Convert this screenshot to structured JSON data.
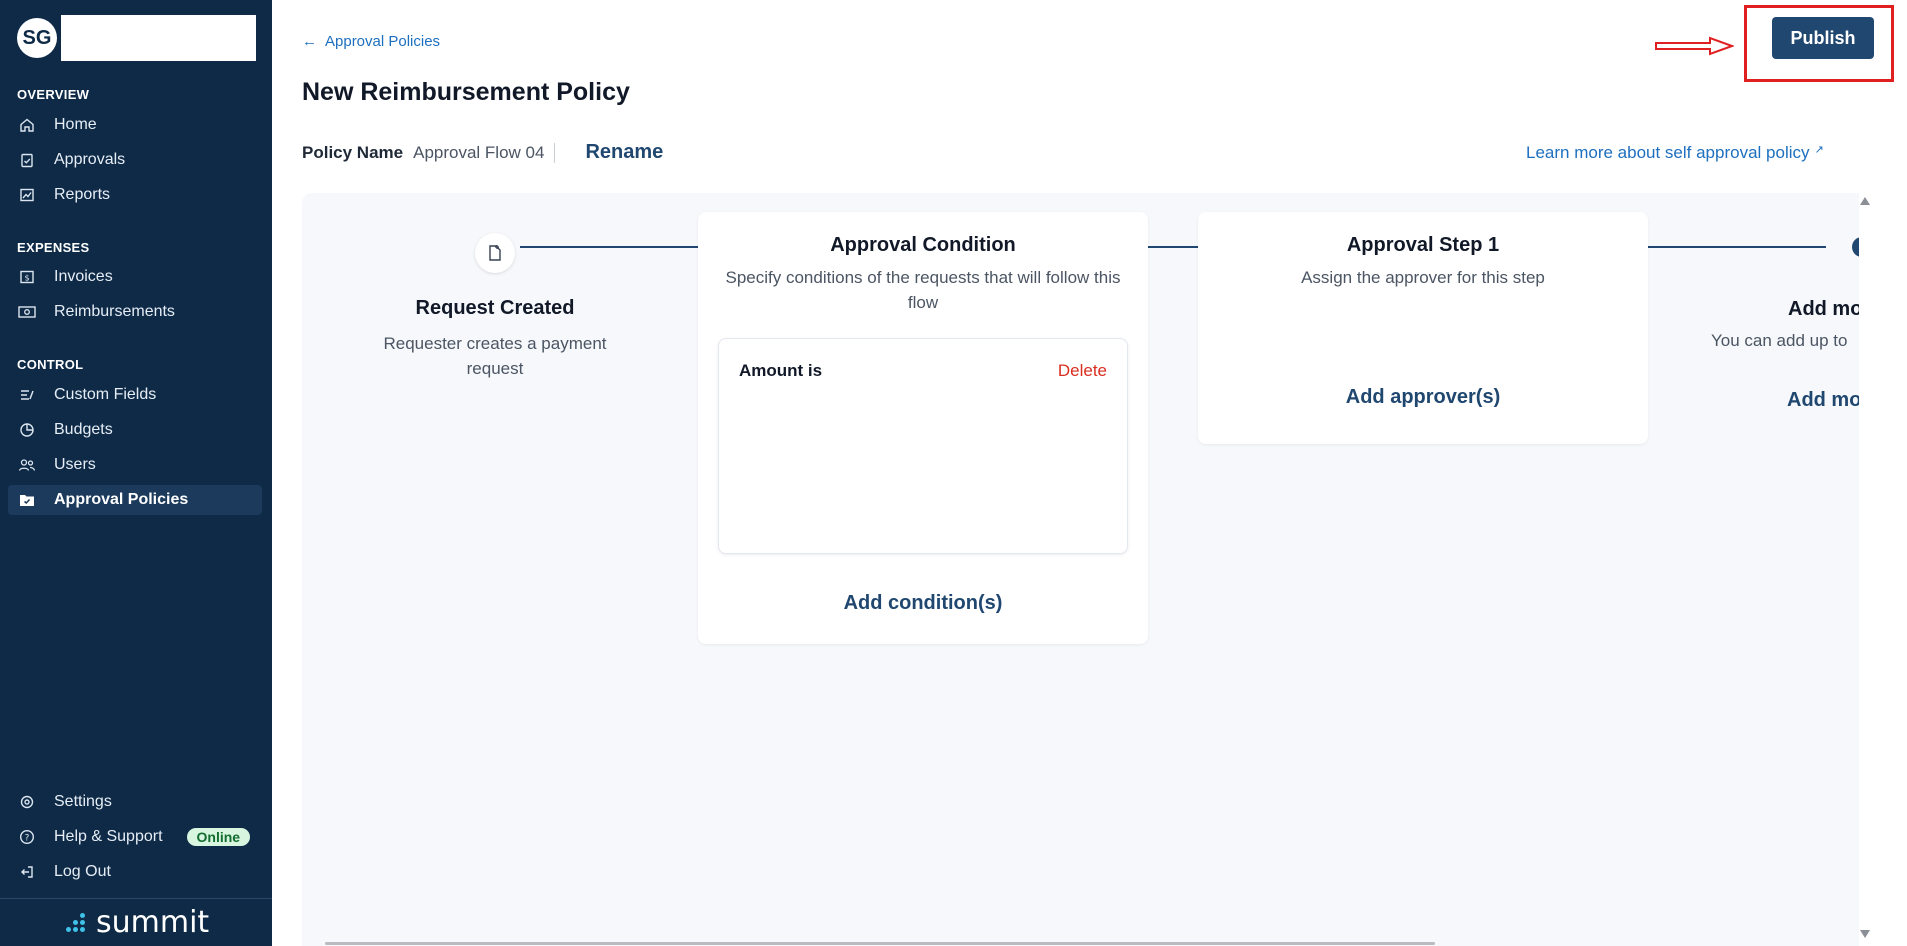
{
  "sidebar": {
    "org_initials": "SG",
    "sections": {
      "overview": "OVERVIEW",
      "expenses": "EXPENSES",
      "control": "CONTROL"
    },
    "items": {
      "home": "Home",
      "approvals": "Approvals",
      "reports": "Reports",
      "invoices": "Invoices",
      "reimbursements": "Reimbursements",
      "custom_fields": "Custom Fields",
      "budgets": "Budgets",
      "users": "Users",
      "approval_policies": "Approval Policies",
      "settings": "Settings",
      "help_support": "Help & Support",
      "log_out": "Log Out"
    },
    "online_badge": "Online",
    "brand": "summit",
    "active_item": "approval_policies"
  },
  "header": {
    "back_link": "Approval Policies",
    "title": "New Reimbursement Policy",
    "publish": "Publish"
  },
  "policy": {
    "label": "Policy Name",
    "value": "Approval Flow 04",
    "rename": "Rename",
    "learn_more": "Learn more about self approval policy"
  },
  "flow": {
    "request_created": {
      "title": "Request Created",
      "desc": "Requester creates a payment request"
    },
    "approval_condition": {
      "title": "Approval Condition",
      "desc": "Specify conditions of the requests that will follow this flow",
      "condition_label": "Amount is",
      "delete": "Delete",
      "add": "Add condition(s)"
    },
    "approval_step": {
      "title": "Approval Step 1",
      "desc": "Assign the approver for this step",
      "add": "Add approver(s)"
    },
    "add_more": {
      "title": "Add mo",
      "desc": "You can add up to",
      "add": "Add mo"
    }
  },
  "colors": {
    "sidebar_bg": "#0e2a47",
    "primary": "#1f4770",
    "link": "#1d6fbf",
    "danger": "#d92d20",
    "annotation": "#e02020"
  }
}
